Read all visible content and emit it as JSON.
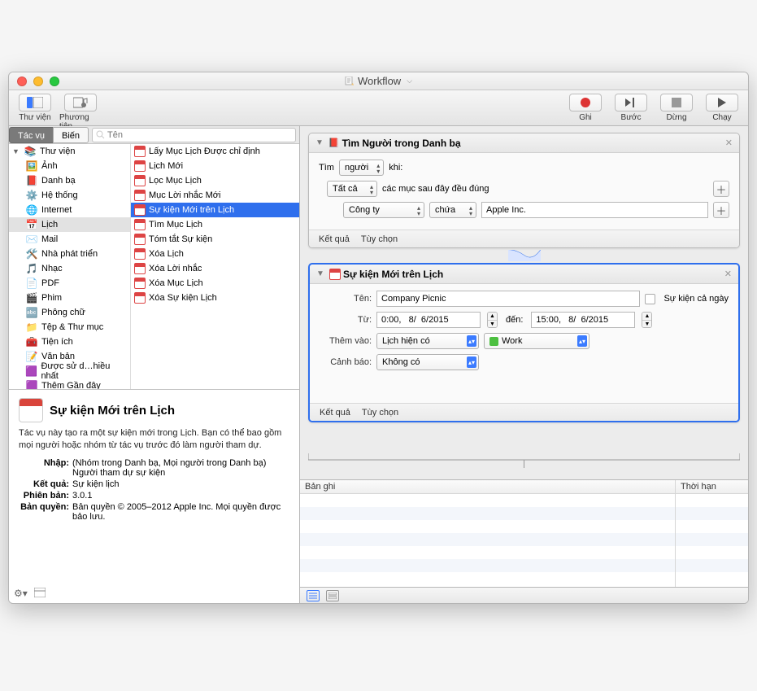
{
  "window_title": "Workflow",
  "toolbar": {
    "library": "Thư viện",
    "media": "Phương tiện",
    "record": "Ghi",
    "step": "Bước",
    "stop": "Dừng",
    "run": "Chạy"
  },
  "segments": {
    "actions": "Tác vụ",
    "variables": "Biến"
  },
  "search_placeholder": "Tên",
  "library_root": "Thư viện",
  "library_items": [
    "Ảnh",
    "Danh bạ",
    "Hệ thống",
    "Internet",
    "Lịch",
    "Mail",
    "Nhà phát triển",
    "Nhạc",
    "PDF",
    "Phim",
    "Phông chữ",
    "Tệp & Thư mục",
    "Tiện ích",
    "Văn bản",
    "Được sử d…hiều nhất",
    "Thêm Gần đây"
  ],
  "actions_list": [
    "Lấy Mục Lịch Được chỉ định",
    "Lịch Mới",
    "Lọc Mục Lịch",
    "Mục Lời nhắc Mới",
    "Sự kiện Mới trên Lịch",
    "Tìm Mục Lịch",
    "Tóm tắt Sự kiện",
    "Xóa Lịch",
    "Xóa Lời nhắc",
    "Xóa Mục Lịch",
    "Xóa Sự kiện Lịch"
  ],
  "info": {
    "title": "Sự kiện Mới trên Lịch",
    "desc": "Tác vụ này tạo ra một sự kiện mới trong Lịch. Bạn có thể bao gồm mọi người hoặc nhóm từ tác vụ trước đó làm người tham dự.",
    "input_k": "Nhập:",
    "input_v": "(Nhóm trong Danh bạ, Mọi người trong Danh bạ) Người tham dự sự kiện",
    "result_k": "Kết quả:",
    "result_v": "Sự kiện lịch",
    "version_k": "Phiên bản:",
    "version_v": "3.0.1",
    "copyright_k": "Bản quyền:",
    "copyright_v": "Bản quyền © 2005–2012 Apple Inc.  Mọi quyền được bảo lưu."
  },
  "action1": {
    "title": "Tìm Người trong Danh bạ",
    "find": "Tìm",
    "people": "người",
    "when": "khi:",
    "all": "Tất cả",
    "match_suffix": "các mục sau đây đều đúng",
    "field": "Công ty",
    "op": "chứa",
    "value": "Apple Inc.",
    "results": "Kết quả",
    "options": "Tùy chọn"
  },
  "action2": {
    "title": "Sự kiện Mới trên Lịch",
    "name_k": "Tên:",
    "name_v": "Company Picnic",
    "allday": "Sự kiện cả ngày",
    "from_k": "Từ:",
    "from_v": "0:00,   8/  6/2015",
    "to_k": "đến:",
    "to_v": "15:00,   8/  6/2015",
    "addto_k": "Thêm vào:",
    "addto_v": "Lịch hiện có",
    "calendar_v": "Work",
    "alert_k": "Cảnh báo:",
    "alert_v": "Không có",
    "results": "Kết quả",
    "options": "Tùy chọn"
  },
  "log": {
    "col1": "Bản ghi",
    "col2": "Thời hạn"
  }
}
